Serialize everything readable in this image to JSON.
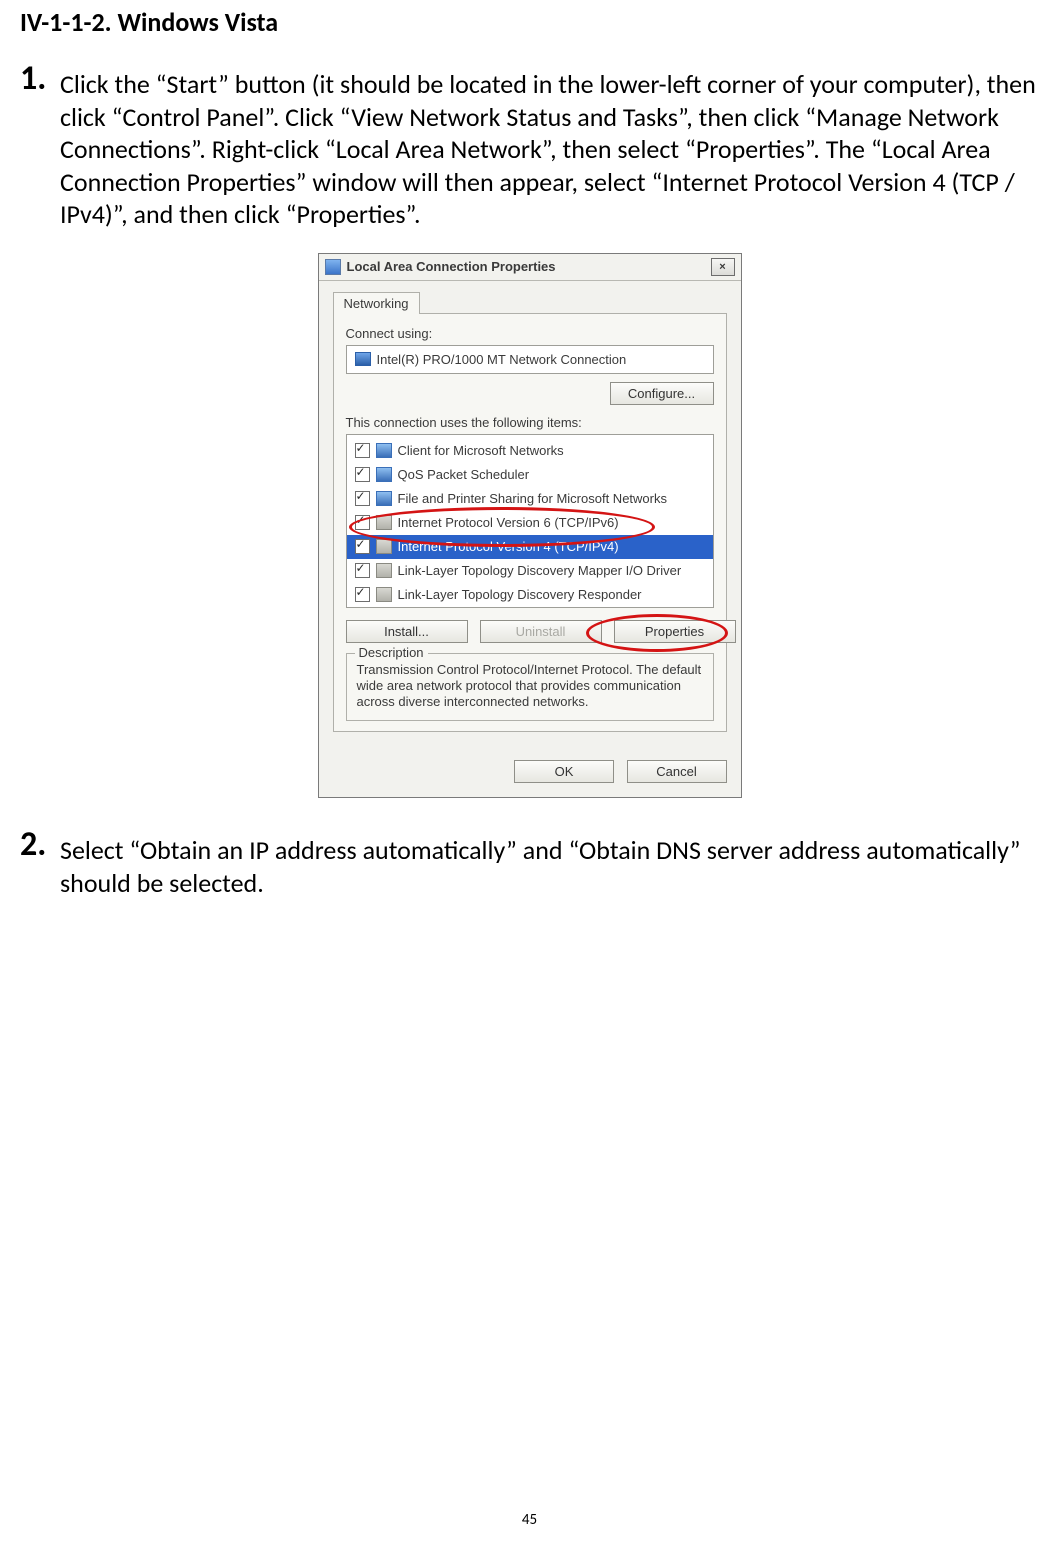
{
  "section_heading": "IV-1-1-2.    Windows Vista",
  "step1": {
    "number": "1.",
    "text": "Click the “Start” button (it should be located in the lower-left corner of your computer), then click “Control Panel”. Click “View Network Status and Tasks”, then click “Manage Network Connections”. Right-click “Local Area Network”, then select “Properties”. The “Local Area Connection Properties” window will then appear, select “Internet Protocol Version 4 (TCP / IPv4)”, and then click “Properties”."
  },
  "step2": {
    "number": "2.",
    "text": "Select “Obtain an IP address automatically” and “Obtain DNS server address automatically” should be selected."
  },
  "dialog": {
    "title": "Local Area Connection Properties",
    "close": "×",
    "tab": "Networking",
    "connect_using_label": "Connect using:",
    "adapter": "Intel(R) PRO/1000 MT Network Connection",
    "configure_btn": "Configure...",
    "items_label": "This connection uses the following items:",
    "items": [
      {
        "label": "Client for Microsoft Networks",
        "iconClass": "net"
      },
      {
        "label": "QoS Packet Scheduler",
        "iconClass": "net"
      },
      {
        "label": "File and Printer Sharing for Microsoft Networks",
        "iconClass": "net"
      },
      {
        "label": "Internet Protocol Version 6 (TCP/IPv6)",
        "iconClass": "link"
      },
      {
        "label": "Internet Protocol Version 4 (TCP/IPv4)",
        "iconClass": "link"
      },
      {
        "label": "Link-Layer Topology Discovery Mapper I/O Driver",
        "iconClass": "link"
      },
      {
        "label": "Link-Layer Topology Discovery Responder",
        "iconClass": "link"
      }
    ],
    "install_btn": "Install...",
    "uninstall_btn": "Uninstall",
    "properties_btn": "Properties",
    "description_legend": "Description",
    "description_text": "Transmission Control Protocol/Internet Protocol. The default wide area network protocol that provides communication across diverse interconnected networks.",
    "ok_btn": "OK",
    "cancel_btn": "Cancel"
  },
  "page_number": "45"
}
